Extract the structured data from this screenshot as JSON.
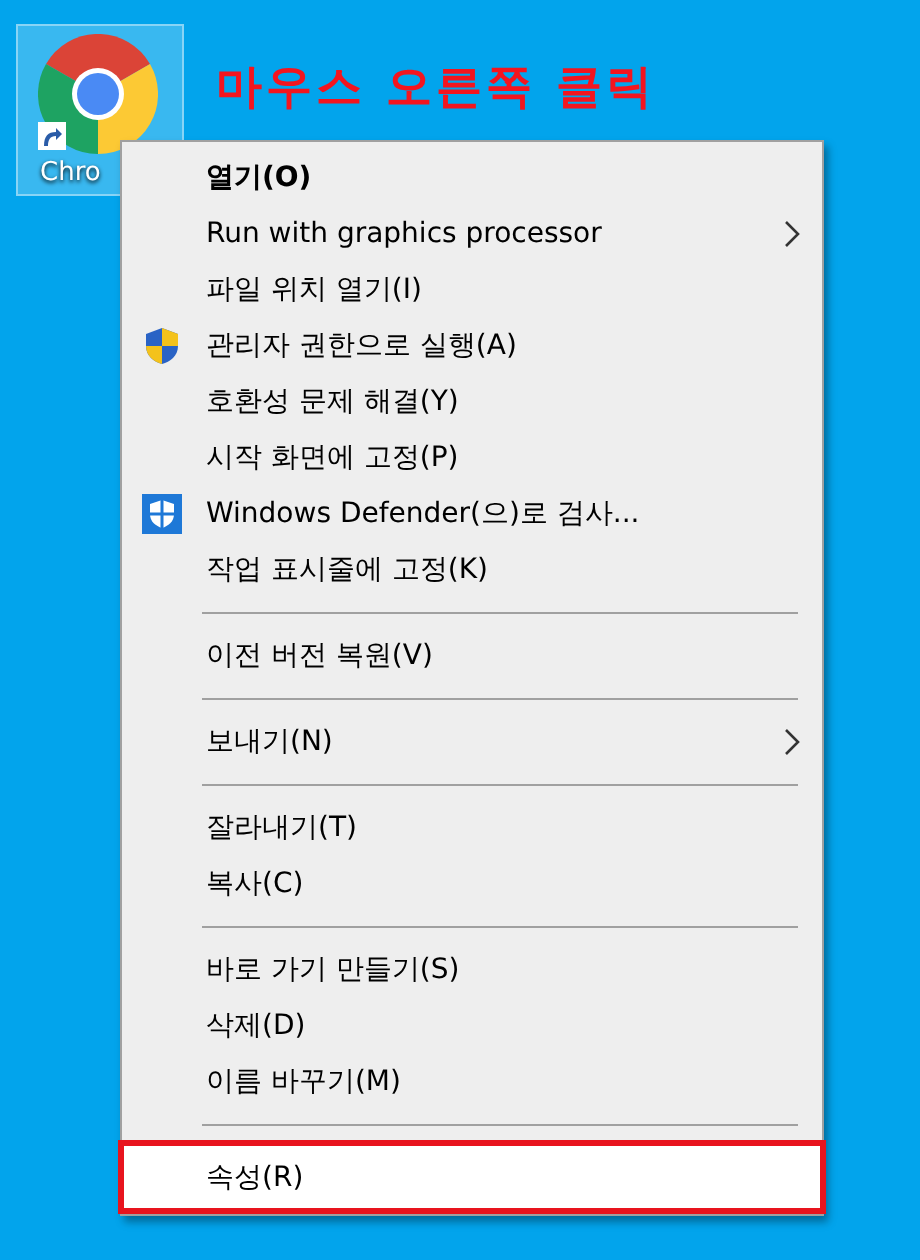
{
  "desktop_icon": {
    "label": "Chro",
    "selected": true
  },
  "annotation": "마우스 오른쪽 클릭",
  "context_menu": {
    "items": [
      {
        "kind": "default",
        "label": "열기(O)",
        "submenu": false,
        "selected": false
      },
      {
        "kind": "item",
        "label": "Run with graphics processor",
        "submenu": true,
        "selected": false
      },
      {
        "kind": "item",
        "label": "파일 위치 열기(I)",
        "submenu": false,
        "selected": false
      },
      {
        "kind": "shield",
        "label": "관리자 권한으로 실행(A)",
        "submenu": false,
        "selected": false
      },
      {
        "kind": "item",
        "label": "호환성 문제 해결(Y)",
        "submenu": false,
        "selected": false
      },
      {
        "kind": "item",
        "label": "시작 화면에 고정(P)",
        "submenu": false,
        "selected": false
      },
      {
        "kind": "defender",
        "label": "Windows Defender(으)로 검사...",
        "submenu": false,
        "selected": false
      },
      {
        "kind": "item",
        "label": "작업 표시줄에 고정(K)",
        "submenu": false,
        "selected": false
      },
      {
        "kind": "separator"
      },
      {
        "kind": "item",
        "label": "이전 버전 복원(V)",
        "submenu": false,
        "selected": false
      },
      {
        "kind": "separator"
      },
      {
        "kind": "item",
        "label": "보내기(N)",
        "submenu": true,
        "selected": false
      },
      {
        "kind": "separator"
      },
      {
        "kind": "item",
        "label": "잘라내기(T)",
        "submenu": false,
        "selected": false
      },
      {
        "kind": "item",
        "label": "복사(C)",
        "submenu": false,
        "selected": false
      },
      {
        "kind": "separator"
      },
      {
        "kind": "item",
        "label": "바로 가기 만들기(S)",
        "submenu": false,
        "selected": false
      },
      {
        "kind": "item",
        "label": "삭제(D)",
        "submenu": false,
        "selected": false
      },
      {
        "kind": "item",
        "label": "이름 바꾸기(M)",
        "submenu": false,
        "selected": false
      },
      {
        "kind": "separator"
      },
      {
        "kind": "item",
        "label": "속성(R)",
        "submenu": false,
        "selected": true
      }
    ]
  }
}
